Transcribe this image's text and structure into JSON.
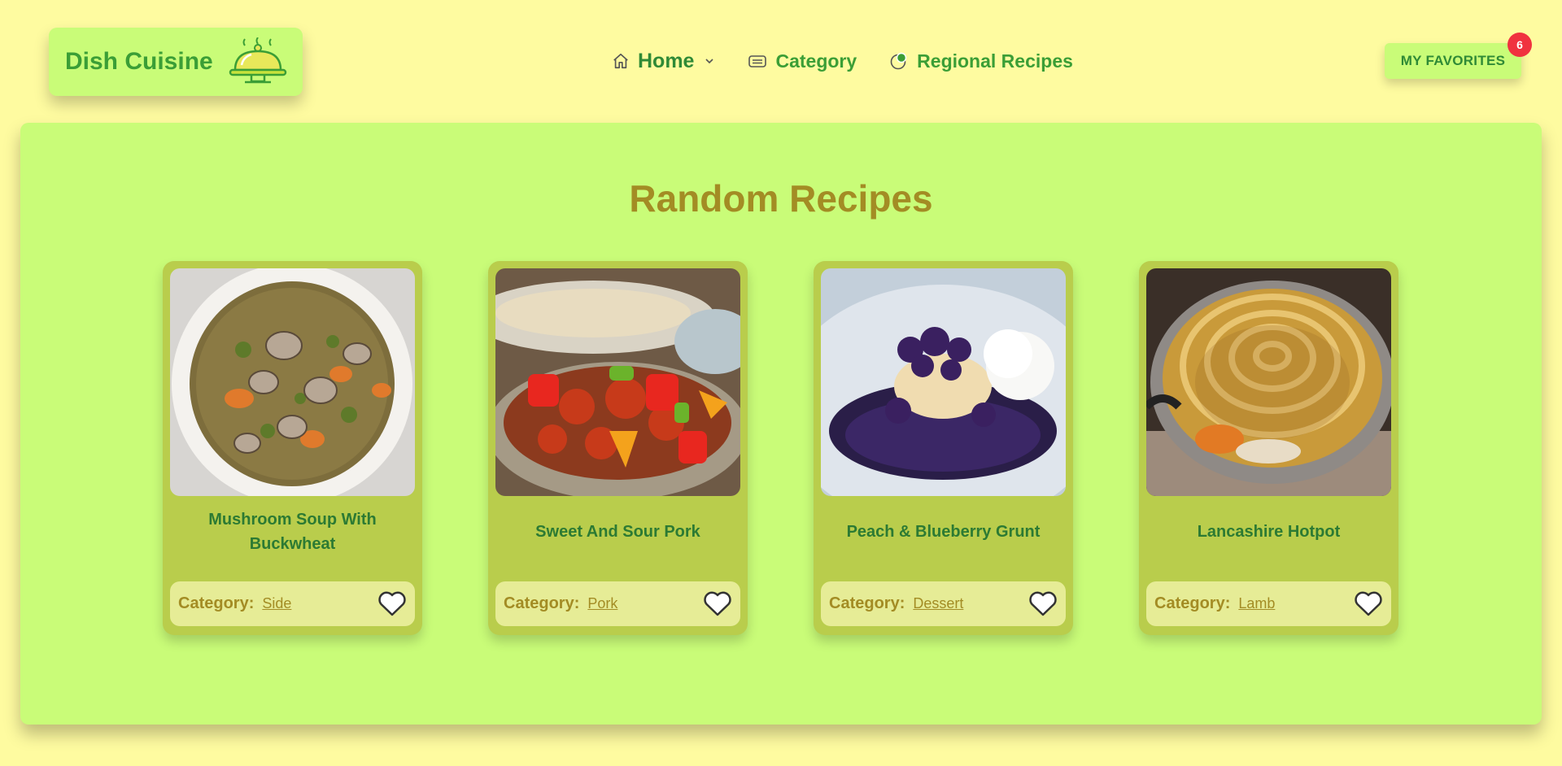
{
  "header": {
    "brand": "Dish Cuisine",
    "logo_icon": "serving-cloche-icon",
    "nav": [
      {
        "label": "Home",
        "icon": "home-icon"
      },
      {
        "label": "Category",
        "icon": "list-icon"
      },
      {
        "label": "Regional Recipes",
        "icon": "globe-icon"
      }
    ],
    "favorites_label": "MY FAVORITES",
    "favorites_count": "6"
  },
  "main": {
    "title": "Random Recipes",
    "category_prefix": "Category:",
    "recipes": [
      {
        "name": "Mushroom Soup With Buckwheat",
        "category": "Side"
      },
      {
        "name": "Sweet And Sour Pork",
        "category": "Pork"
      },
      {
        "name": "Peach & Blueberry Grunt",
        "category": "Dessert"
      },
      {
        "name": "Lancashire Hotpot",
        "category": "Lamb"
      }
    ]
  },
  "colors": {
    "page_bg": "#fefba0",
    "panel_bg": "#c9fc78",
    "card_bg": "#b9cd4c",
    "brand_green": "#3b9e36",
    "title_gold": "#a38c24",
    "badge_red": "#f0323f"
  }
}
